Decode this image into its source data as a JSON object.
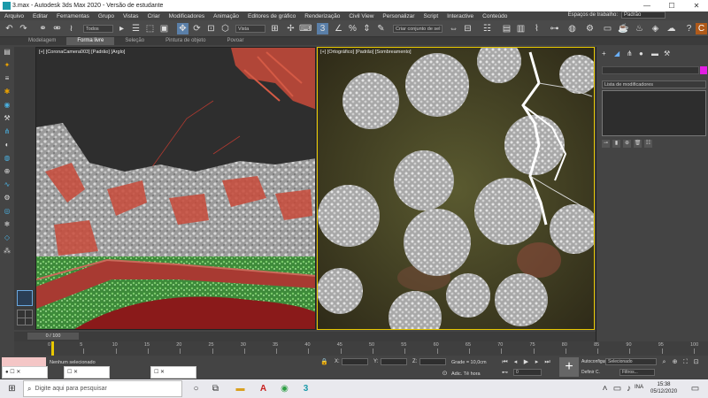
{
  "window": {
    "title": "3.max - Autodesk 3ds Max 2020 - Versão de estudante",
    "minimize": "—",
    "maximize": "☐",
    "close": "✕"
  },
  "menu": {
    "items": [
      "Arquivo",
      "Editar",
      "Ferramentas",
      "Grupo",
      "Vistas",
      "Criar",
      "Modificadores",
      "Animação",
      "Editores de gráfico",
      "Renderização",
      "Civil View",
      "Personalizar",
      "Script",
      "Interactive",
      "Conteúdo"
    ],
    "workspace_label": "Espaços de trabalho:",
    "workspace_value": "Padrão"
  },
  "toolbar": {
    "filter_dropdown": "Todos",
    "view_dropdown": "Vista",
    "selection_set": "Criar conjunto de sel"
  },
  "ribbon": {
    "tabs": [
      "Modelagem",
      "Forma livre",
      "Seleção",
      "Pintura de objeto",
      "Povoar"
    ],
    "active": "Forma livre"
  },
  "viewports": {
    "left_label": "[+] [CoronaCamera003] [Padrão] [Arglo]",
    "right_label": "[+] [Ortográfico] [Padrão] [Sombreamento]"
  },
  "right_panel": {
    "modifier_list": "Lista de modificadores"
  },
  "time_slider": {
    "frame": "0 / 100"
  },
  "trackbar": {
    "ticks": [
      "0",
      "5",
      "10",
      "15",
      "20",
      "25",
      "30",
      "35",
      "40",
      "45",
      "50",
      "55",
      "60",
      "65",
      "70",
      "75",
      "80",
      "85",
      "90",
      "95",
      "100"
    ]
  },
  "status": {
    "selection": "Nenhum selecionado",
    "x_label": "X:",
    "y_label": "Y:",
    "z_label": "Z:",
    "grid": "Grade = 10,0cm",
    "add_time_tag": "Adic. Tê hora",
    "auto_key": "Autoconfigur.",
    "selected_dropdown": "Selecionado",
    "set_key": "Definir C.",
    "filters": "Filtros...",
    "frame_field": "0"
  },
  "taskbar": {
    "search_placeholder": "Digite aqui para pesquisar",
    "language": "INA",
    "time": "15:38",
    "date": "05/12/2020"
  },
  "colors": {
    "accent_active_viewport": "#e8c800",
    "object_color": "#e31ee3"
  }
}
